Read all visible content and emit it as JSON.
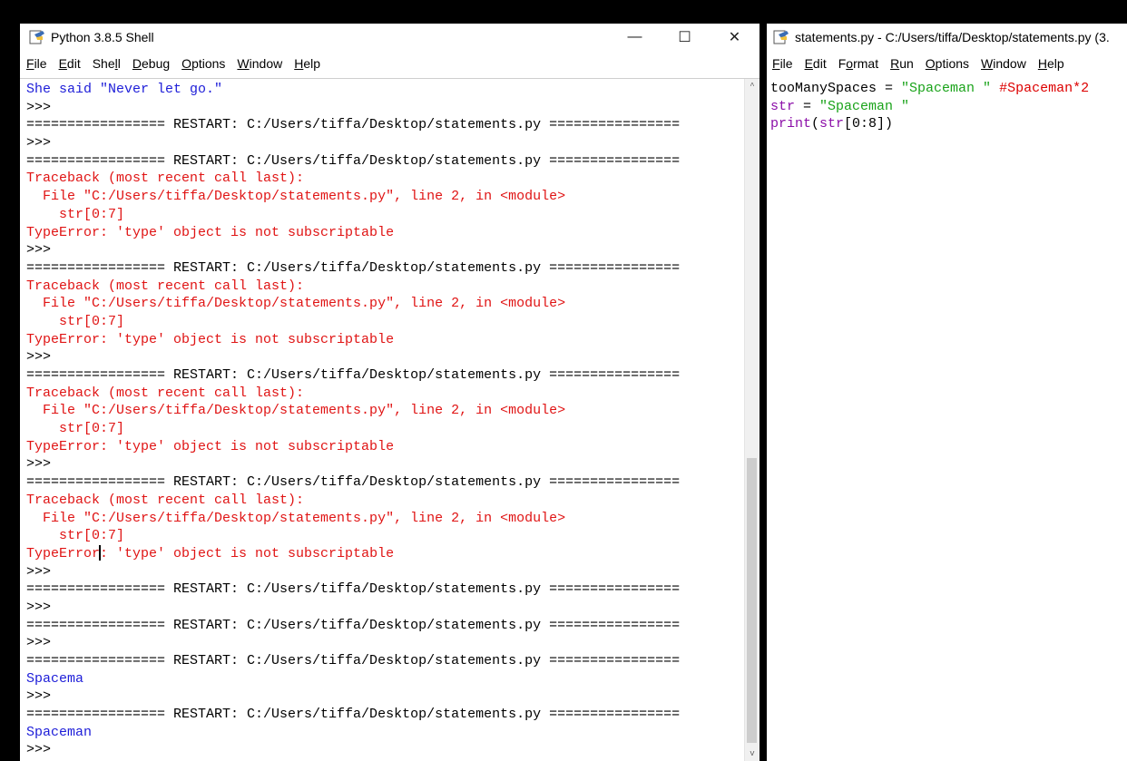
{
  "shell": {
    "title": "Python 3.8.5 Shell",
    "window_controls": {
      "minimize": "—",
      "maximize": "☐",
      "close": "✕"
    },
    "menu": [
      "File",
      "Edit",
      "Shell",
      "Debug",
      "Options",
      "Window",
      "Help"
    ],
    "lines": [
      {
        "text": "She said \"Never let go.\"",
        "style": "blue"
      },
      {
        "text": ">>>",
        "style": "normal"
      },
      {
        "text": "================= RESTART: C:/Users/tiffa/Desktop/statements.py ================",
        "style": "normal"
      },
      {
        "text": ">>>",
        "style": "normal"
      },
      {
        "text": "================= RESTART: C:/Users/tiffa/Desktop/statements.py ================",
        "style": "normal"
      },
      {
        "text": "Traceback (most recent call last):",
        "style": "red"
      },
      {
        "text": "  File \"C:/Users/tiffa/Desktop/statements.py\", line 2, in <module>",
        "style": "red"
      },
      {
        "text": "    str[0:7]",
        "style": "red"
      },
      {
        "text": "TypeError: 'type' object is not subscriptable",
        "style": "red"
      },
      {
        "text": ">>>",
        "style": "normal"
      },
      {
        "text": "================= RESTART: C:/Users/tiffa/Desktop/statements.py ================",
        "style": "normal"
      },
      {
        "text": "Traceback (most recent call last):",
        "style": "red"
      },
      {
        "text": "  File \"C:/Users/tiffa/Desktop/statements.py\", line 2, in <module>",
        "style": "red"
      },
      {
        "text": "    str[0:7]",
        "style": "red"
      },
      {
        "text": "TypeError: 'type' object is not subscriptable",
        "style": "red"
      },
      {
        "text": ">>>",
        "style": "normal"
      },
      {
        "text": "================= RESTART: C:/Users/tiffa/Desktop/statements.py ================",
        "style": "normal"
      },
      {
        "text": "Traceback (most recent call last):",
        "style": "red"
      },
      {
        "text": "  File \"C:/Users/tiffa/Desktop/statements.py\", line 2, in <module>",
        "style": "red"
      },
      {
        "text": "    str[0:7]",
        "style": "red"
      },
      {
        "text": "TypeError: 'type' object is not subscriptable",
        "style": "red"
      },
      {
        "text": ">>>",
        "style": "normal"
      },
      {
        "text": "================= RESTART: C:/Users/tiffa/Desktop/statements.py ================",
        "style": "normal"
      },
      {
        "text": "Traceback (most recent call last):",
        "style": "red"
      },
      {
        "text": "  File \"C:/Users/tiffa/Desktop/statements.py\", line 2, in <module>",
        "style": "red"
      },
      {
        "text": "    str[0:7]",
        "style": "red"
      },
      {
        "text": "TypeError: 'type' object is not subscriptable",
        "style": "red",
        "cursor_after": 9
      },
      {
        "text": ">>>",
        "style": "normal"
      },
      {
        "text": "================= RESTART: C:/Users/tiffa/Desktop/statements.py ================",
        "style": "normal"
      },
      {
        "text": ">>>",
        "style": "normal"
      },
      {
        "text": "================= RESTART: C:/Users/tiffa/Desktop/statements.py ================",
        "style": "normal"
      },
      {
        "text": ">>>",
        "style": "normal"
      },
      {
        "text": "================= RESTART: C:/Users/tiffa/Desktop/statements.py ================",
        "style": "normal"
      },
      {
        "text": "Spacema",
        "style": "blue"
      },
      {
        "text": ">>>",
        "style": "normal"
      },
      {
        "text": "================= RESTART: C:/Users/tiffa/Desktop/statements.py ================",
        "style": "normal"
      },
      {
        "text": "Spaceman",
        "style": "blue"
      },
      {
        "text": ">>>",
        "style": "normal"
      }
    ]
  },
  "editor": {
    "title": "statements.py - C:/Users/tiffa/Desktop/statements.py (3.",
    "menu": [
      "File",
      "Edit",
      "Format",
      "Run",
      "Options",
      "Window",
      "Help"
    ],
    "lines": [
      [
        {
          "t": "tooManySpaces = ",
          "c": "kw"
        },
        {
          "t": "\"Spaceman \"",
          "c": "str"
        },
        {
          "t": " #Spaceman*2",
          "c": "cmt"
        }
      ],
      [
        {
          "t": "str",
          "c": "bi"
        },
        {
          "t": " = ",
          "c": "kw"
        },
        {
          "t": "\"Spaceman \"",
          "c": "str"
        }
      ],
      [
        {
          "t": "print",
          "c": "bi"
        },
        {
          "t": "(",
          "c": "kw"
        },
        {
          "t": "str",
          "c": "bi"
        },
        {
          "t": "[0:8])",
          "c": "kw"
        }
      ]
    ]
  },
  "colors": {
    "output_blue": "#1d1dd8",
    "error_red": "#e01414",
    "string_green": "#1aa31a",
    "comment_red": "#dd0000",
    "builtin_purple": "#8b0ea8"
  },
  "icons": {
    "app": "python-idle-icon"
  }
}
